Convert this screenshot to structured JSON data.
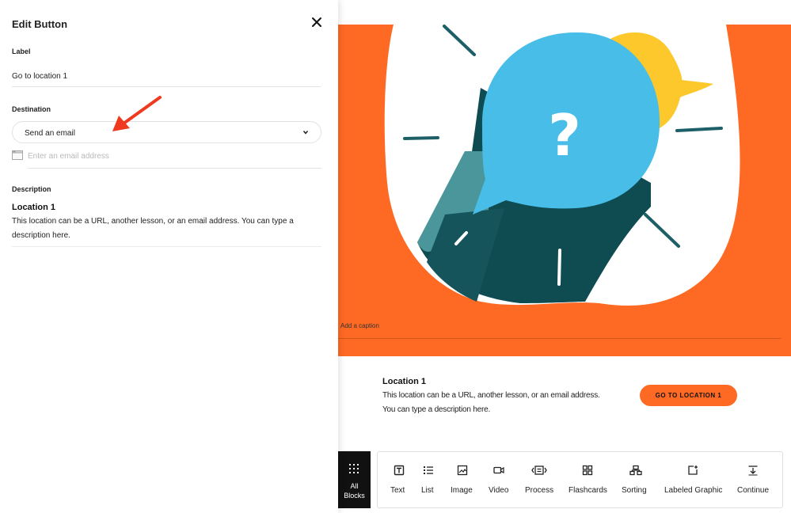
{
  "panel": {
    "title": "Edit Button",
    "label_field": {
      "label": "Label",
      "value": "Go to location 1"
    },
    "destination_field": {
      "label": "Destination",
      "selected": "Send an email",
      "email_placeholder": "Enter an email address"
    },
    "description_field": {
      "label": "Description",
      "heading": "Location 1",
      "body": "This location can be a URL, another lesson, or an email address. You can type a description here."
    }
  },
  "canvas": {
    "image_caption": "Add a caption",
    "card": {
      "title": "Location 1",
      "body": "This location can be a URL, another lesson, or an email address. You can type a description here.",
      "button_label": "GO TO LOCATION 1"
    },
    "accent_color": "#fe6a24"
  },
  "blocks_bar": {
    "all_blocks_line1": "All",
    "all_blocks_line2": "Blocks",
    "items": [
      {
        "label": "Text",
        "icon": "text-icon"
      },
      {
        "label": "List",
        "icon": "list-icon"
      },
      {
        "label": "Image",
        "icon": "image-icon"
      },
      {
        "label": "Video",
        "icon": "video-icon"
      },
      {
        "label": "Process",
        "icon": "process-icon"
      },
      {
        "label": "Flashcards",
        "icon": "flashcards-icon"
      },
      {
        "label": "Sorting",
        "icon": "sorting-icon"
      },
      {
        "label": "Labeled Graphic",
        "icon": "labeled-graphic-icon"
      },
      {
        "label": "Continue",
        "icon": "continue-icon"
      }
    ]
  }
}
